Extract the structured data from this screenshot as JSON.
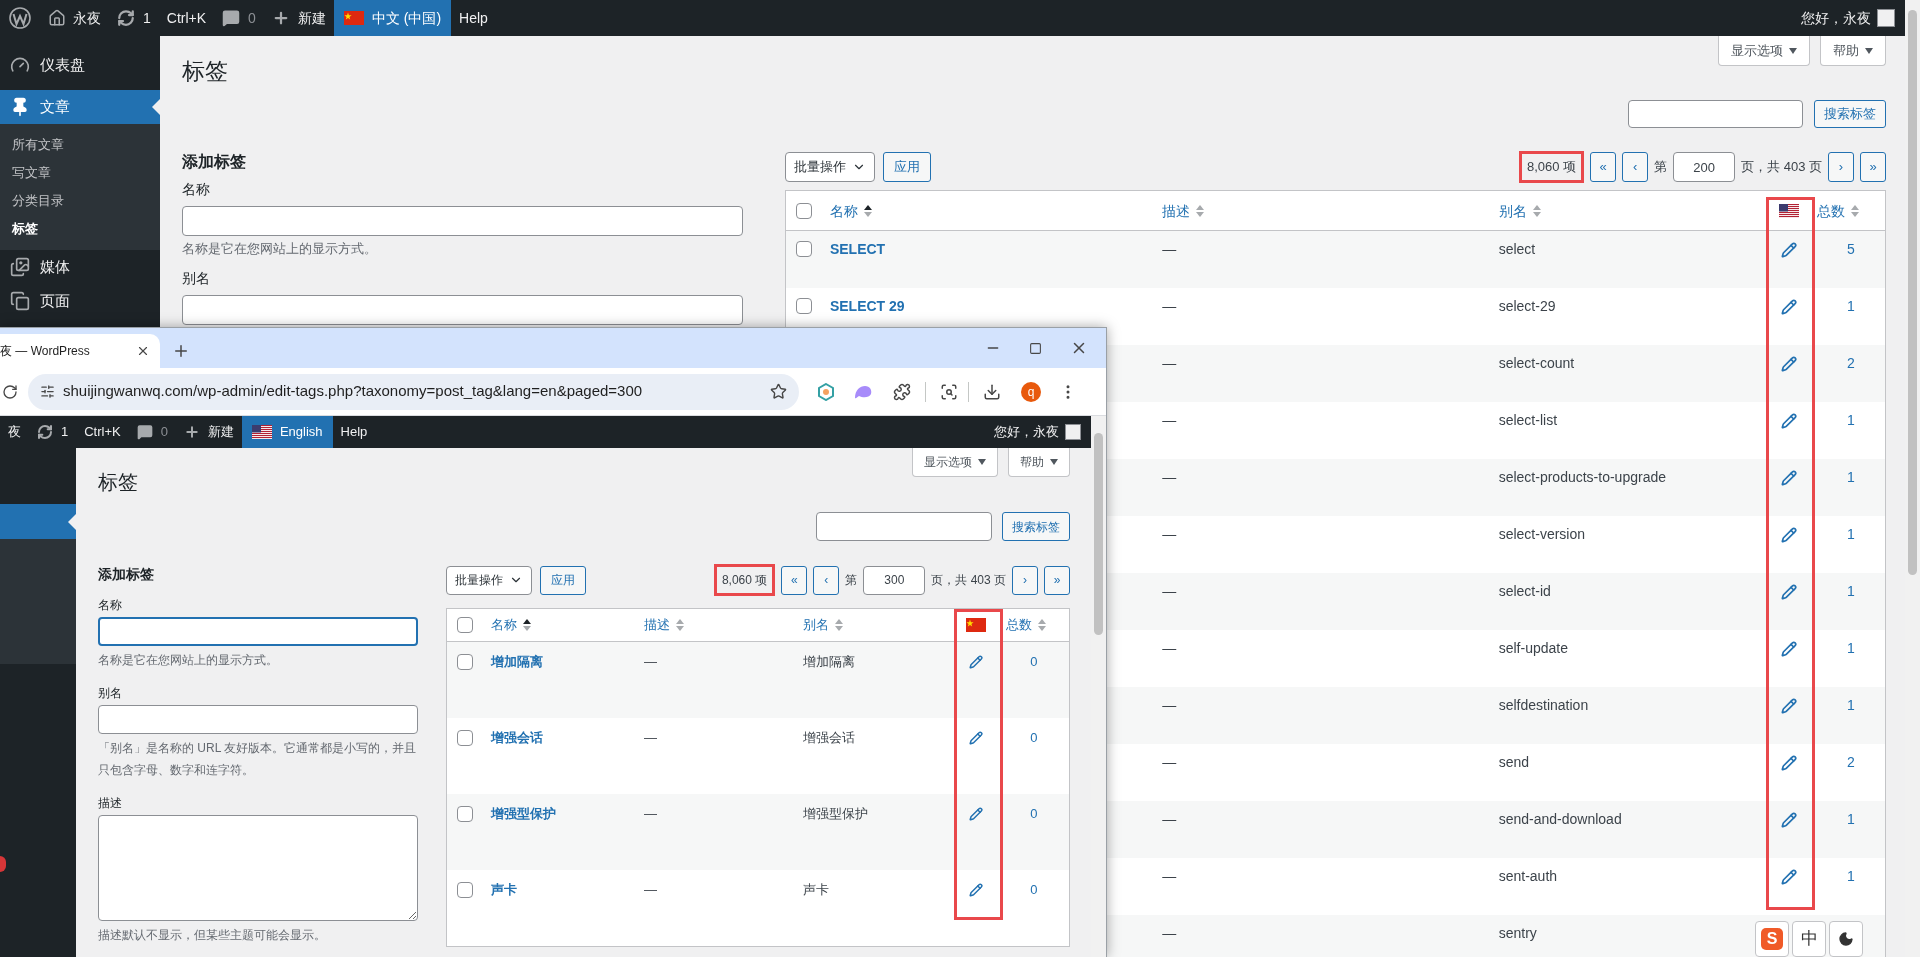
{
  "admin_bar": {
    "logo": true,
    "items": [
      {
        "kind": "home",
        "label": "永夜"
      },
      {
        "kind": "updates",
        "label": "1"
      },
      {
        "kind": "text",
        "label": "Ctrl+K"
      },
      {
        "kind": "comments",
        "label": "0"
      },
      {
        "kind": "new",
        "label": "新建"
      },
      {
        "kind": "cnlanguage",
        "label": "中文 (中国)",
        "selected": true
      },
      {
        "kind": "text",
        "label": "Help"
      }
    ],
    "greeting": "您好，永夜"
  },
  "sidebar": {
    "items": [
      {
        "label": "仪表盘",
        "selected": false
      },
      {
        "label": "文章",
        "selected": true,
        "children": [
          {
            "label": "所有文章",
            "selected": false
          },
          {
            "label": "写文章",
            "selected": false
          },
          {
            "label": "分类目录",
            "selected": false
          },
          {
            "label": "标签",
            "selected": true
          }
        ]
      },
      {
        "label": "媒体",
        "selected": false
      },
      {
        "label": "页面",
        "selected": false
      }
    ]
  },
  "page": {
    "title": "标签",
    "screen_options": [
      {
        "label": "显示选项"
      },
      {
        "label": "帮助"
      }
    ],
    "search_button": "搜索标签",
    "add_form": {
      "heading": "添加标签",
      "fields": [
        {
          "kind": "input",
          "label": "名称",
          "help": "名称是它在您网站上的显示方式。",
          "focused": false
        },
        {
          "kind": "input",
          "label": "别名",
          "focused": false
        }
      ]
    },
    "toolbar": {
      "bulk_action": "批量操作",
      "apply": "应用",
      "count": "8,060 项",
      "count_highlighted": true,
      "nav_before": [
        "«",
        "‹"
      ],
      "page_label": "第",
      "page": "200",
      "total": "页，共 403 页",
      "nav_after": [
        "›",
        "»"
      ]
    },
    "table": {
      "all_checked": false,
      "columns": [
        {
          "kind": "text",
          "label": "名称",
          "sorted": true
        },
        {
          "kind": "text",
          "label": "描述",
          "sorted": false
        },
        {
          "kind": "text",
          "label": "别名",
          "sorted": false
        },
        {
          "kind": "usflag",
          "highlighted": true
        },
        {
          "kind": "text",
          "label": "总数",
          "sorted": false
        }
      ],
      "rows": [
        {
          "name": "SELECT",
          "checked": false,
          "description": "—",
          "slug": "select",
          "count": "5"
        },
        {
          "name": "SELECT 29",
          "checked": false,
          "description": "—",
          "slug": "select-29",
          "count": "1"
        },
        {
          "description": "—",
          "slug": "select-count",
          "count": "2"
        },
        {
          "description": "—",
          "slug": "select-list",
          "count": "1"
        },
        {
          "description": "—",
          "slug": "select-products-to-upgrade",
          "count": "1"
        },
        {
          "description": "—",
          "slug": "select-version",
          "count": "1"
        },
        {
          "description": "—",
          "slug": "select-id",
          "count": "1"
        },
        {
          "description": "—",
          "slug": "self-update",
          "count": "1"
        },
        {
          "description": "—",
          "slug": "selfdestination",
          "count": "1"
        },
        {
          "description": "—",
          "slug": "send",
          "count": "2"
        },
        {
          "description": "—",
          "slug": "send-and-download",
          "count": "1"
        },
        {
          "description": "—",
          "slug": "sent-auth",
          "count": "1"
        },
        {
          "description": "—",
          "slug": "sentry"
        }
      ]
    }
  },
  "browser_window": {
    "tab_title": "夜 — WordPress",
    "url": "shuijingwanwq.com/wp-admin/edit-tags.php?taxonomy=post_tag&lang=en&paged=300",
    "profile": "q",
    "admin_bar": {
      "items": [
        {
          "kind": "text",
          "label": "夜"
        },
        {
          "kind": "updates",
          "label": "1"
        },
        {
          "kind": "text",
          "label": "Ctrl+K"
        },
        {
          "kind": "comments",
          "label": "0"
        },
        {
          "kind": "new",
          "label": "新建"
        },
        {
          "kind": "uslanguage",
          "label": "English",
          "selected": true
        },
        {
          "kind": "text",
          "label": "Help"
        }
      ],
      "greeting": "您好，永夜"
    },
    "page": {
      "title": "标签",
      "screen_options": [
        {
          "label": "显示选项"
        },
        {
          "label": "帮助"
        }
      ],
      "search_button": "搜索标签",
      "add_form": {
        "heading": "添加标签",
        "fields": [
          {
            "kind": "input",
            "label": "名称",
            "help": "名称是它在您网站上的显示方式。",
            "focused": true
          },
          {
            "kind": "input",
            "label": "别名",
            "help": "「别名」是名称的 URL 友好版本。它通常都是小写的，并且只包含字母、数字和连字符。",
            "focused": false
          },
          {
            "kind": "textarea",
            "label": "描述",
            "help": "描述默认不显示，但某些主题可能会显示。",
            "focused": false
          }
        ]
      },
      "toolbar": {
        "bulk_action": "批量操作",
        "apply": "应用",
        "count": "8,060 项",
        "count_highlighted": true,
        "nav_before": [
          "«",
          "‹"
        ],
        "page_label": "第",
        "page": "300",
        "total": "页，共 403 页",
        "nav_after": [
          "›",
          "»"
        ]
      },
      "table": {
        "all_checked": false,
        "columns": [
          {
            "kind": "text",
            "label": "名称",
            "sorted": true
          },
          {
            "kind": "text",
            "label": "描述",
            "sorted": false
          },
          {
            "kind": "text",
            "label": "别名",
            "sorted": false
          },
          {
            "kind": "cnflag",
            "highlighted": true
          },
          {
            "kind": "text",
            "label": "总数",
            "sorted": false
          }
        ],
        "rows": [
          {
            "name": "增加隔离",
            "checked": false,
            "description": "—",
            "slug": "增加隔离",
            "count": "0"
          },
          {
            "name": "增强会话",
            "checked": false,
            "description": "—",
            "slug": "增强会话",
            "count": "0"
          },
          {
            "name": "增强型保护",
            "checked": false,
            "description": "—",
            "slug": "增强型保护",
            "count": "0"
          },
          {
            "name": "声卡",
            "checked": false,
            "description": "—",
            "slug": "声卡",
            "count": "0"
          }
        ]
      }
    }
  },
  "ime_toolbar": {
    "logo": "S",
    "mode": "中"
  }
}
